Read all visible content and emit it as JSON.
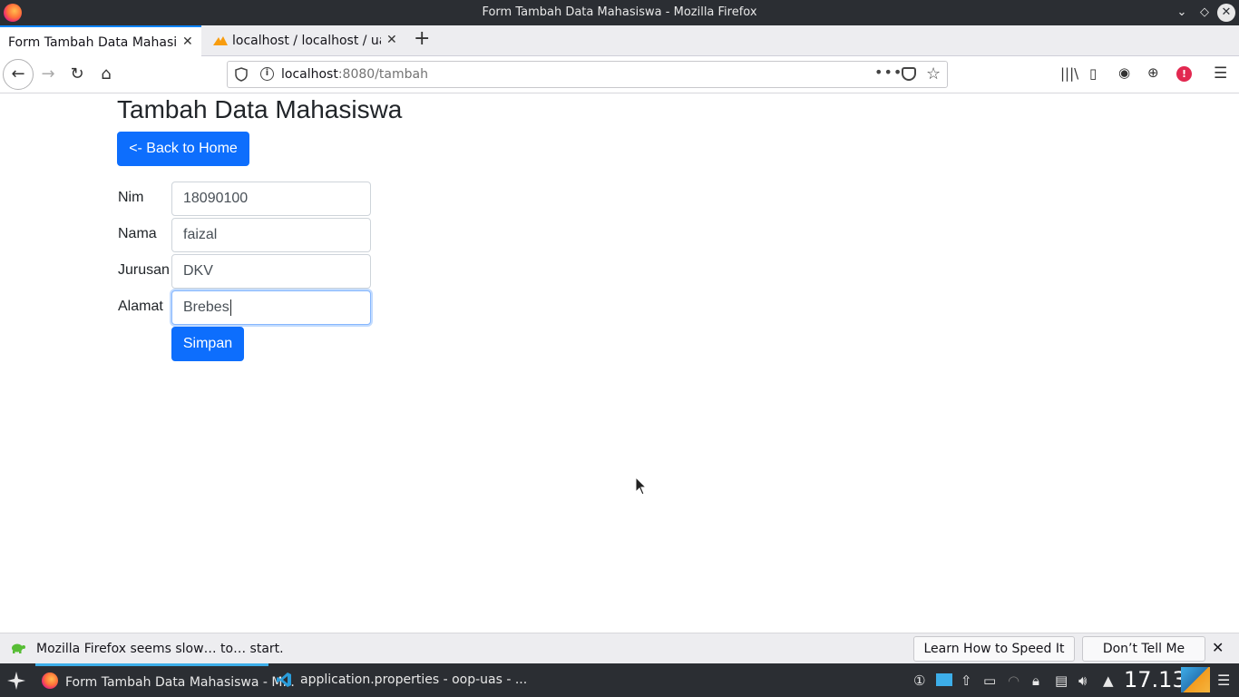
{
  "window": {
    "title": "Form Tambah Data Mahasiswa - Mozilla Firefox"
  },
  "tabs": [
    {
      "label": "Form Tambah Data Mahasiswa",
      "active": true
    },
    {
      "label": "localhost / localhost / uas_",
      "active": false
    }
  ],
  "navbar": {
    "url_host": "localhost",
    "url_rest": ":8080/tambah",
    "page_actions": "•••"
  },
  "page": {
    "heading": "Tambah Data Mahasiswa",
    "back_button": "<- Back to Home",
    "form": {
      "fields": [
        {
          "label": "Nim",
          "value": "18090100"
        },
        {
          "label": "Nama",
          "value": "faizal"
        },
        {
          "label": "Jurusan",
          "value": "DKV"
        },
        {
          "label": "Alamat",
          "value": "Brebes"
        }
      ],
      "submit_label": "Simpan"
    },
    "colors": {
      "primary": "#0d6efd"
    }
  },
  "notification": {
    "text": "Mozilla Firefox seems slow… to… start.",
    "button_learn": "Learn How to Speed It Up",
    "button_dismiss": "Don’t Tell Me Again"
  },
  "taskbar": {
    "tasks": [
      {
        "label": "Form Tambah Data Mahasiswa - M...",
        "active": true
      },
      {
        "label": "application.properties - oop-uas - ...",
        "active": false
      }
    ],
    "clock": "17.13"
  }
}
